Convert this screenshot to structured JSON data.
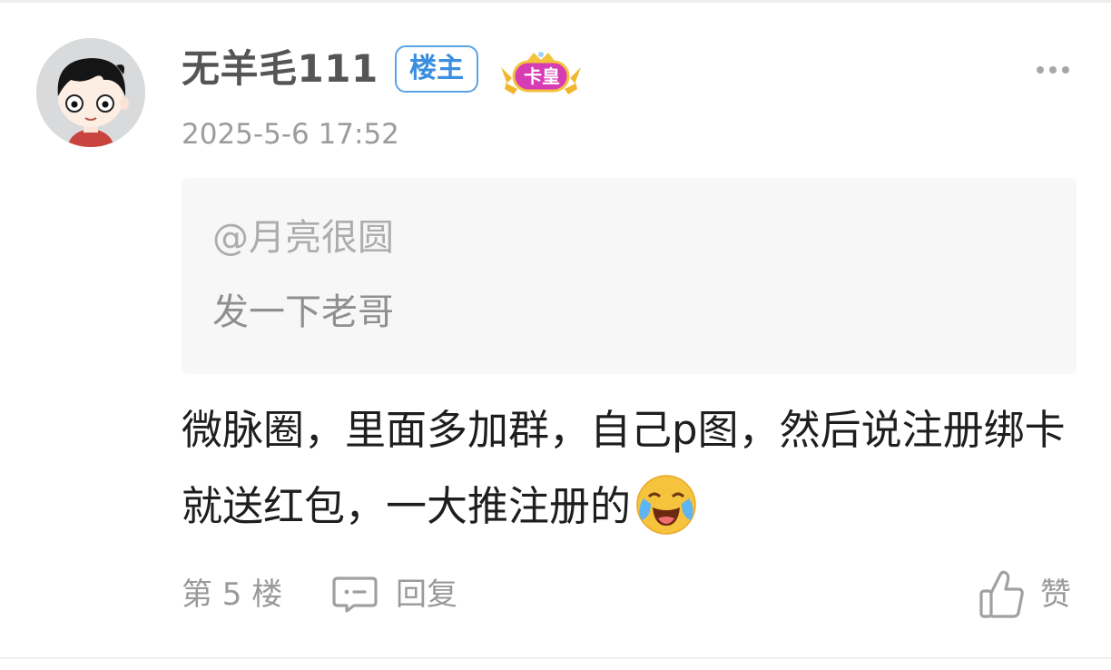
{
  "post": {
    "author": {
      "name": "无羊毛111",
      "owner_badge": "楼主",
      "rank_badge": "卡皇",
      "avatar_icon": "cartoon-boy-avatar"
    },
    "timestamp": "2025-5-6 17:52",
    "quote": {
      "mention": "@月亮很圆",
      "text": "发一下老哥"
    },
    "body": "微脉圈，里面多加群，自己p图，然后说注册绑卡就送红包，一大推注册的",
    "body_emoji": "crying-laughing-emoji",
    "footer": {
      "floor": "第 5 楼",
      "reply_label": "回复",
      "like_label": "赞"
    }
  },
  "icons": {
    "more": "more-dots-icon",
    "reply": "comment-bubble-icon",
    "like": "thumbs-up-icon"
  },
  "colors": {
    "owner_badge": "#3b8fe0",
    "rank_badge": "#d63cb4",
    "crown_gold": "#f1b72c",
    "text_primary": "#1e1e1e",
    "text_secondary": "#9a9a9a",
    "quote_background": "#f7f7f7"
  }
}
